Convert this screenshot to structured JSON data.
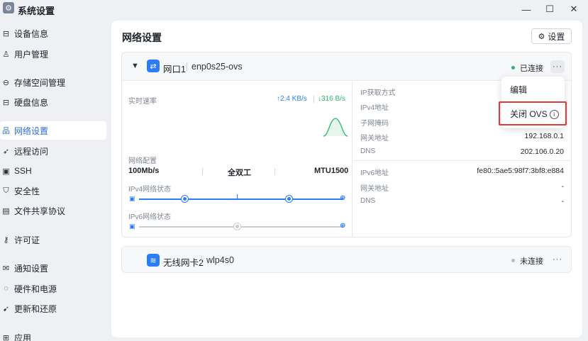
{
  "window": {
    "title": "系统设置",
    "minimize_glyph": "—",
    "maximize_glyph": "☐",
    "close_glyph": "✕"
  },
  "sidebar": {
    "items": [
      {
        "label": "设备信息",
        "icon": "device-info-icon",
        "glyph": "⊟"
      },
      {
        "label": "用户管理",
        "icon": "user-icon",
        "glyph": "♙"
      },
      {
        "label": "存储空间管理",
        "icon": "storage-icon",
        "glyph": "⊖"
      },
      {
        "label": "硬盘信息",
        "icon": "disk-icon",
        "glyph": "⊟"
      },
      {
        "label": "网络设置",
        "icon": "network-icon",
        "glyph": "品",
        "active": true
      },
      {
        "label": "远程访问",
        "icon": "remote-access-icon",
        "glyph": "➶"
      },
      {
        "label": "SSH",
        "icon": "terminal-icon",
        "glyph": "▣"
      },
      {
        "label": "安全性",
        "icon": "shield-icon",
        "glyph": "⛉"
      },
      {
        "label": "文件共享协议",
        "icon": "file-share-icon",
        "glyph": "▤"
      },
      {
        "label": "许可证",
        "icon": "key-icon",
        "glyph": "⚷"
      },
      {
        "label": "通知设置",
        "icon": "mail-icon",
        "glyph": "✉"
      },
      {
        "label": "硬件和电源",
        "icon": "hardware-icon",
        "glyph": "◌"
      },
      {
        "label": "更新和还原",
        "icon": "rocket-icon",
        "glyph": "➹"
      },
      {
        "label": "应用",
        "icon": "apps-icon",
        "glyph": "⊞"
      }
    ]
  },
  "main": {
    "title": "网络设置",
    "settings_button": "设置",
    "interfaces": [
      {
        "name": "网口1",
        "device": "enp0s25-ovs",
        "status": "已连接",
        "status_color": "#2bb673",
        "more": "···",
        "realtime_label": "实时速率",
        "upload": "↑2.4 KB/s",
        "download": "↓316 B/s",
        "config_label": "网络配置",
        "speed": "100Mb/s",
        "duplex": "全双工",
        "mtu": "MTU1500",
        "ipv4_state_label": "IPv4网络状态",
        "ipv6_state_label": "IPv6网络状态",
        "ipv4_connected": true,
        "ipv6_connected": false,
        "details": {
          "ip_method_label": "IP获取方式",
          "ipv4_label": "IPv4地址",
          "mask_label": "子网掩码",
          "gateway_label": "网关地址",
          "gateway": "192.168.0.1",
          "dns_label": "DNS",
          "dns": "202.106.0.20",
          "ipv6_label": "IPv6地址",
          "ipv6": "fe80::5ae5:98f7:3bf8:e884",
          "gateway6_label": "网关地址",
          "gateway6": "-",
          "dns6_label": "DNS",
          "dns6": "-"
        }
      },
      {
        "name": "无线网卡2",
        "device": "wlp4s0",
        "status": "未连接",
        "status_color": "#b8bcc3",
        "more": "···"
      }
    ]
  },
  "context_menu": {
    "items": [
      {
        "label": "编辑"
      },
      {
        "label": "关闭 OVS"
      }
    ],
    "highlight_color": "#e53935"
  }
}
